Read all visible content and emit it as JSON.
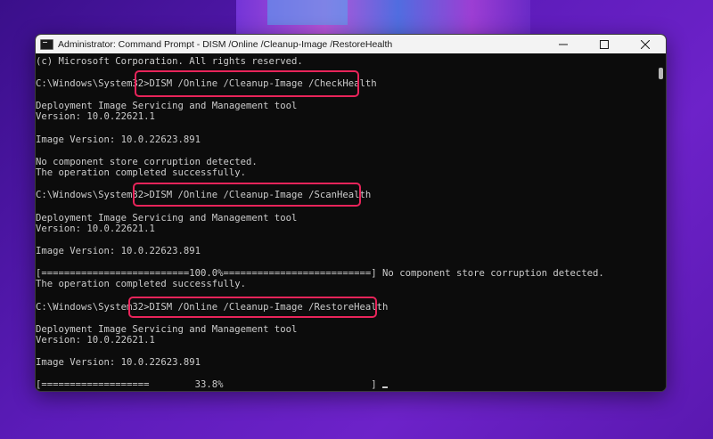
{
  "window": {
    "title": "Administrator: Command Prompt - DISM  /Online /Cleanup-Image /RestoreHealth",
    "controls": {
      "minimize_icon": "minimize-icon",
      "maximize_icon": "maximize-icon",
      "close_icon": "close-icon"
    }
  },
  "console": {
    "lines": [
      "(c) Microsoft Corporation. All rights reserved.",
      "",
      "C:\\Windows\\System32>DISM /Online /Cleanup-Image /CheckHealth",
      "",
      "Deployment Image Servicing and Management tool",
      "Version: 10.0.22621.1",
      "",
      "Image Version: 10.0.22623.891",
      "",
      "No component store corruption detected.",
      "The operation completed successfully.",
      "",
      "C:\\Windows\\System32>DISM /Online /Cleanup-Image /ScanHealth",
      "",
      "Deployment Image Servicing and Management tool",
      "Version: 10.0.22621.1",
      "",
      "Image Version: 10.0.22623.891",
      "",
      "[==========================100.0%==========================] No component store corruption detected.",
      "The operation completed successfully.",
      "",
      "C:\\Windows\\System32>DISM /Online /Cleanup-Image /RestoreHealth",
      "",
      "Deployment Image Servicing and Management tool",
      "Version: 10.0.22621.1",
      "",
      "Image Version: 10.0.22623.891",
      "",
      "[===================        33.8%                          ] "
    ],
    "restore_progress_percent": 33.8
  },
  "colors": {
    "highlight": "#e8245a",
    "console_bg": "#0c0c0c",
    "console_text": "#cccccc",
    "titlebar_bg": "#f3f3f3"
  }
}
